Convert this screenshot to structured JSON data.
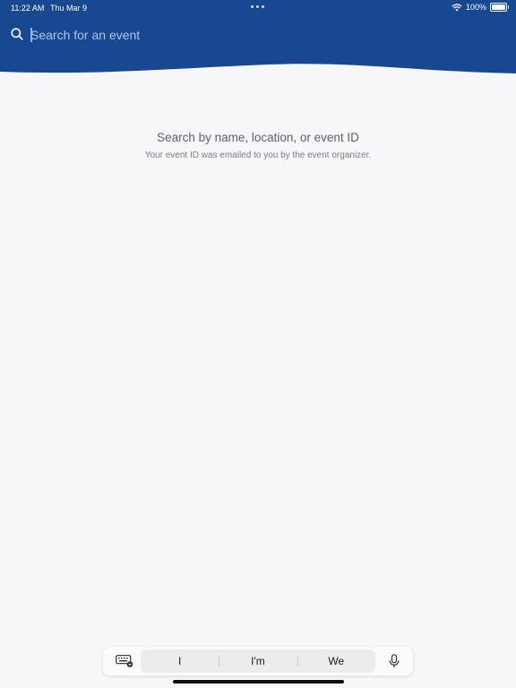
{
  "status_bar": {
    "time": "11:22 AM",
    "date": "Thu Mar 9",
    "battery_text": "100%",
    "wifi_icon": "wifi-icon",
    "battery_icon": "battery-icon"
  },
  "header": {
    "background_color": "#184891",
    "search": {
      "placeholder": "Search for an event",
      "value": ""
    }
  },
  "empty_state": {
    "title": "Search by name, location, or event ID",
    "subtitle": "Your event ID was emailed to you by the event organizer."
  },
  "keyboard_bar": {
    "suggestions": [
      "I",
      "I'm",
      "We"
    ],
    "keyboard_icon": "keyboard-icon",
    "mic_icon": "microphone-icon"
  }
}
